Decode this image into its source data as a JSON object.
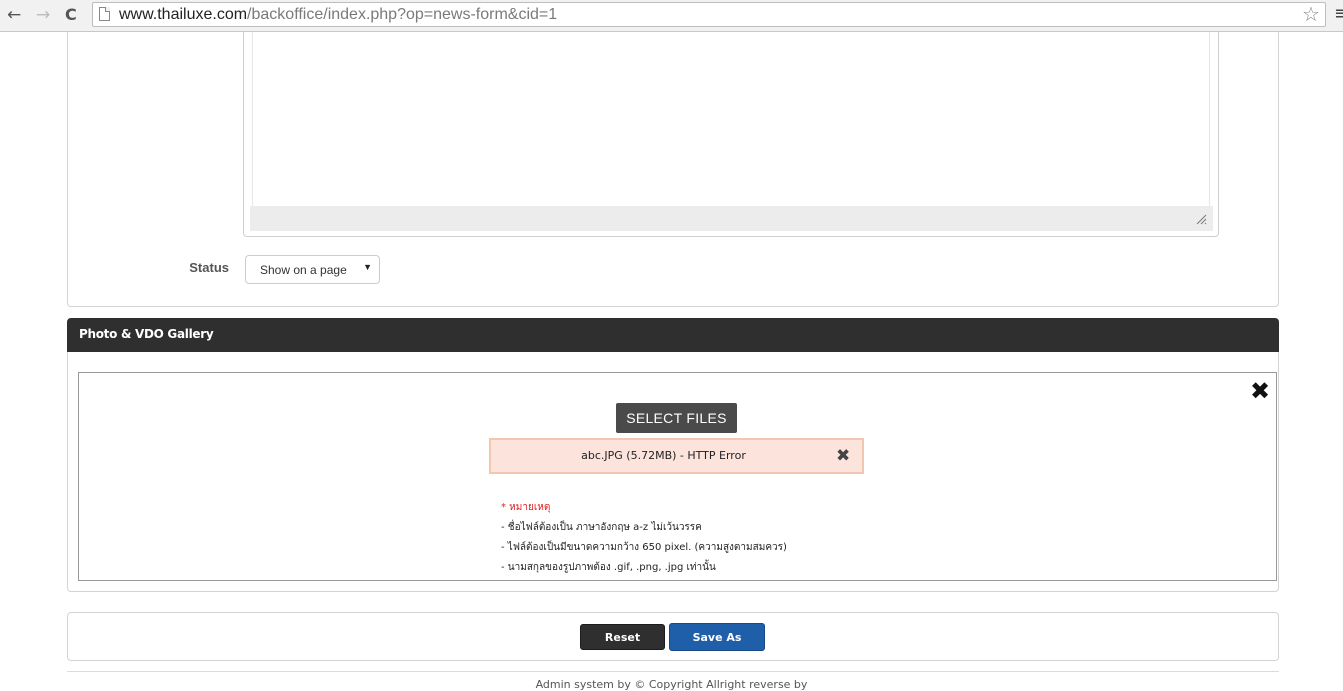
{
  "browser": {
    "url_host": "www.thailuxe.com",
    "url_path": "/backoffice/index.php?op=news-form&cid=1",
    "back_icon": "back-arrow-icon",
    "forward_icon": "forward-arrow-icon",
    "reload_icon": "reload-icon",
    "star_icon": "star-icon",
    "menu_icon": "menu-icon"
  },
  "form": {
    "status_label": "Status",
    "status_value": "Show on a page"
  },
  "gallery": {
    "title": "Photo & VDO Gallery",
    "select_files_label": "SELECT FILES",
    "error_text": "abc.JPG (5.72MB) - HTTP Error",
    "notes": {
      "heading": "* หมายเหตุ",
      "lines": [
        "- ชื่อไฟล์ต้องเป็น ภาษาอังกฤษ a-z ไม่เว้นวรรค",
        "- ไฟล์ต้องเป็นมีขนาดความกว้าง 650 pixel. (ความสูงตามสมควร)",
        "- นามสกุลของรูปภาพต้อง .gif, .png, .jpg เท่านั้น"
      ]
    }
  },
  "actions": {
    "reset_label": "Reset",
    "save_label": "Save As"
  },
  "footer": {
    "text": "Admin system by © Copyright Allright reverse by"
  },
  "colors": {
    "header_dark": "#2f2f2f",
    "save_blue": "#1f5ea8",
    "error_bg": "#fce4dc",
    "note_red": "#e31b1b"
  }
}
